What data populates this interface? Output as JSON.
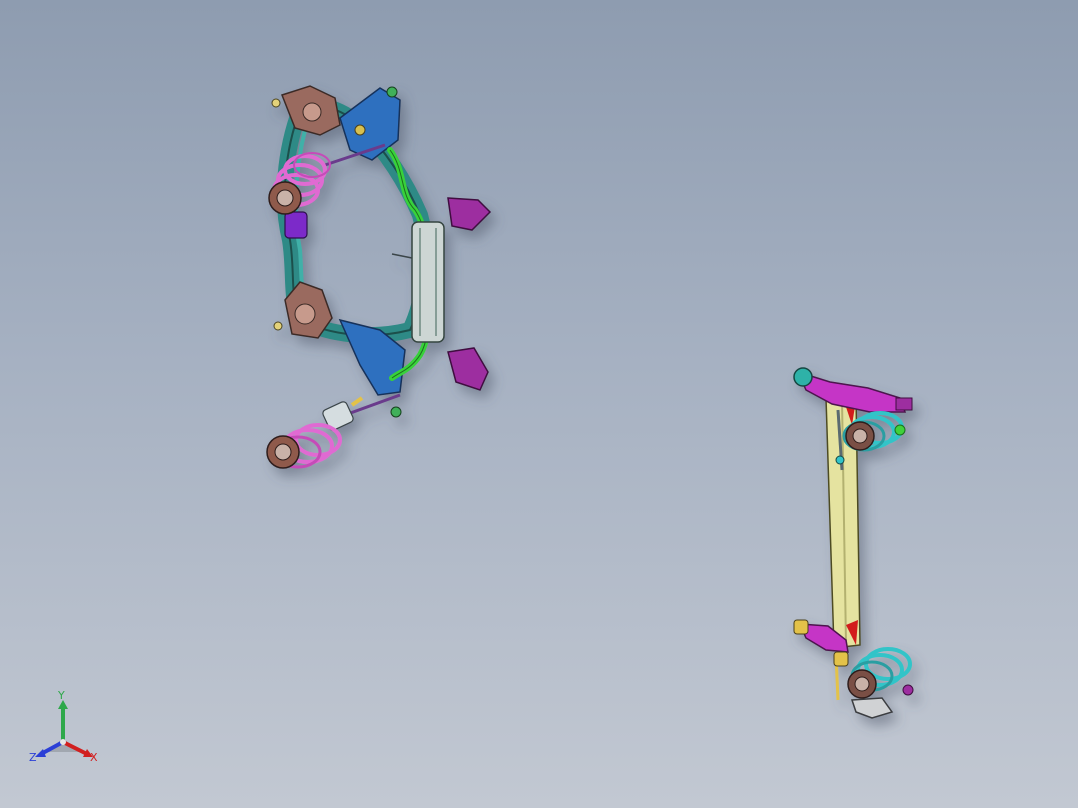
{
  "viewport": {
    "background_top": "#8e9cb0",
    "background_bottom": "#c2c8d2"
  },
  "model": {
    "front_subframe": "front-suspension-subframe-assembly",
    "rear_axle": "rear-twist-beam-axle-assembly"
  },
  "triad": {
    "y_label": "Y",
    "z_label": "Z",
    "x_label": "X",
    "colors": {
      "x": "#d11f1f",
      "y": "#2ea84a",
      "z": "#2b3fd6"
    }
  }
}
